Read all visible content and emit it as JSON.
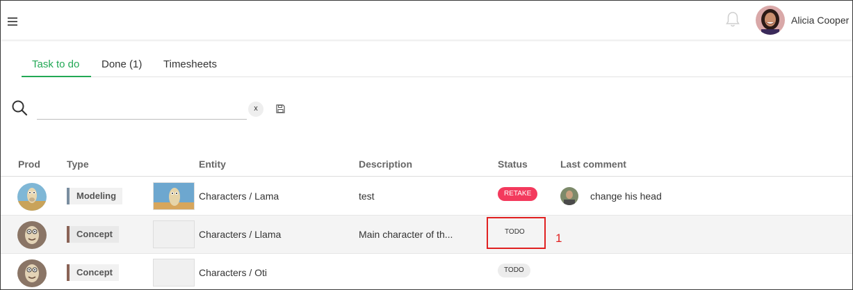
{
  "header": {
    "user_name": "Alicia Cooper",
    "menu_icon": "hamburger-menu-icon",
    "notification_icon": "bell-icon"
  },
  "tabs": [
    {
      "label": "Task to do",
      "active": true
    },
    {
      "label": "Done (1)",
      "active": false
    },
    {
      "label": "Timesheets",
      "active": false
    }
  ],
  "search": {
    "value": "",
    "placeholder": "",
    "clear_label": "x"
  },
  "table": {
    "columns": [
      "Prod",
      "Type",
      "Entity",
      "Description",
      "Status",
      "Last comment"
    ],
    "rows": [
      {
        "type": "Modeling",
        "entity": "Characters / Lama",
        "description": "test",
        "status": "RETAKE",
        "last_comment": "change his head"
      },
      {
        "type": "Concept",
        "entity": "Characters / Llama",
        "description": "Main character of th...",
        "status": "TODO",
        "last_comment": ""
      },
      {
        "type": "Concept",
        "entity": "Characters / Oti",
        "description": "",
        "status": "TODO",
        "last_comment": ""
      }
    ]
  },
  "annotation": {
    "label": "1"
  },
  "colors": {
    "accent": "#22a855",
    "retake": "#f33a5d",
    "annotation": "#e02020",
    "modeling_tag": "#7a8ea0",
    "concept_tag": "#8a6356"
  }
}
